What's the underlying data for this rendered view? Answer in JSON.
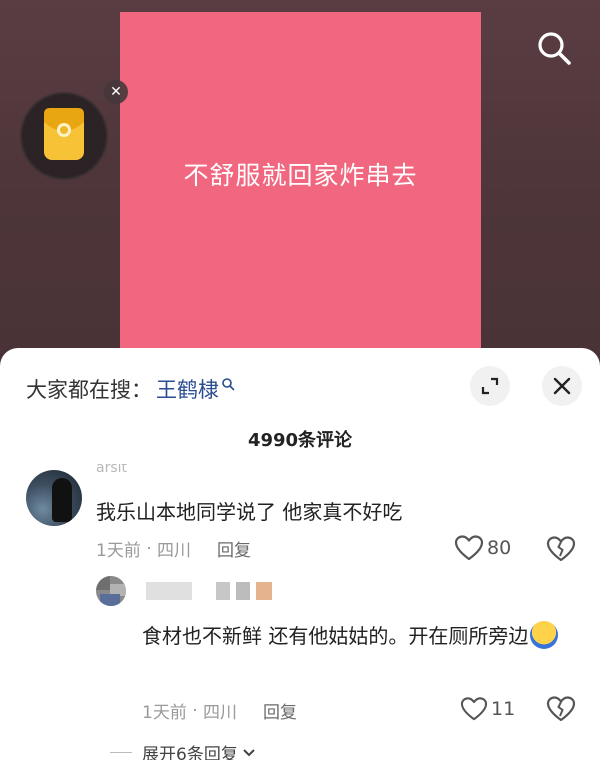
{
  "video": {
    "caption": "不舒服就回家炸串去",
    "card_color": "#f1677f"
  },
  "icons": {
    "top_search": "search-icon",
    "red_packet": "red-packet-icon",
    "red_packet_close": "close-icon",
    "trend_search": "search-icon",
    "expand": "expand-icon",
    "close": "close-icon",
    "like": "heart-icon",
    "dislike": "broken-heart-icon",
    "more": "chevron-down-icon"
  },
  "sheet": {
    "trending_prefix": "大家都在搜：",
    "trending_term": "王鹤棣",
    "comment_count": "4990条评论"
  },
  "comments": [
    {
      "username": "arsit",
      "text": "我乐山本地同学说了 他家真不好吃",
      "time": "1天前",
      "location": "四川",
      "reply_label": "回复",
      "likes": "80"
    }
  ],
  "replies": [
    {
      "text": "食材也不新鲜 还有他姑姑的。开在厕所旁边",
      "time": "1天前",
      "location": "四川",
      "reply_label": "回复",
      "likes": "11"
    }
  ],
  "expand_replies": "展开6条回复"
}
